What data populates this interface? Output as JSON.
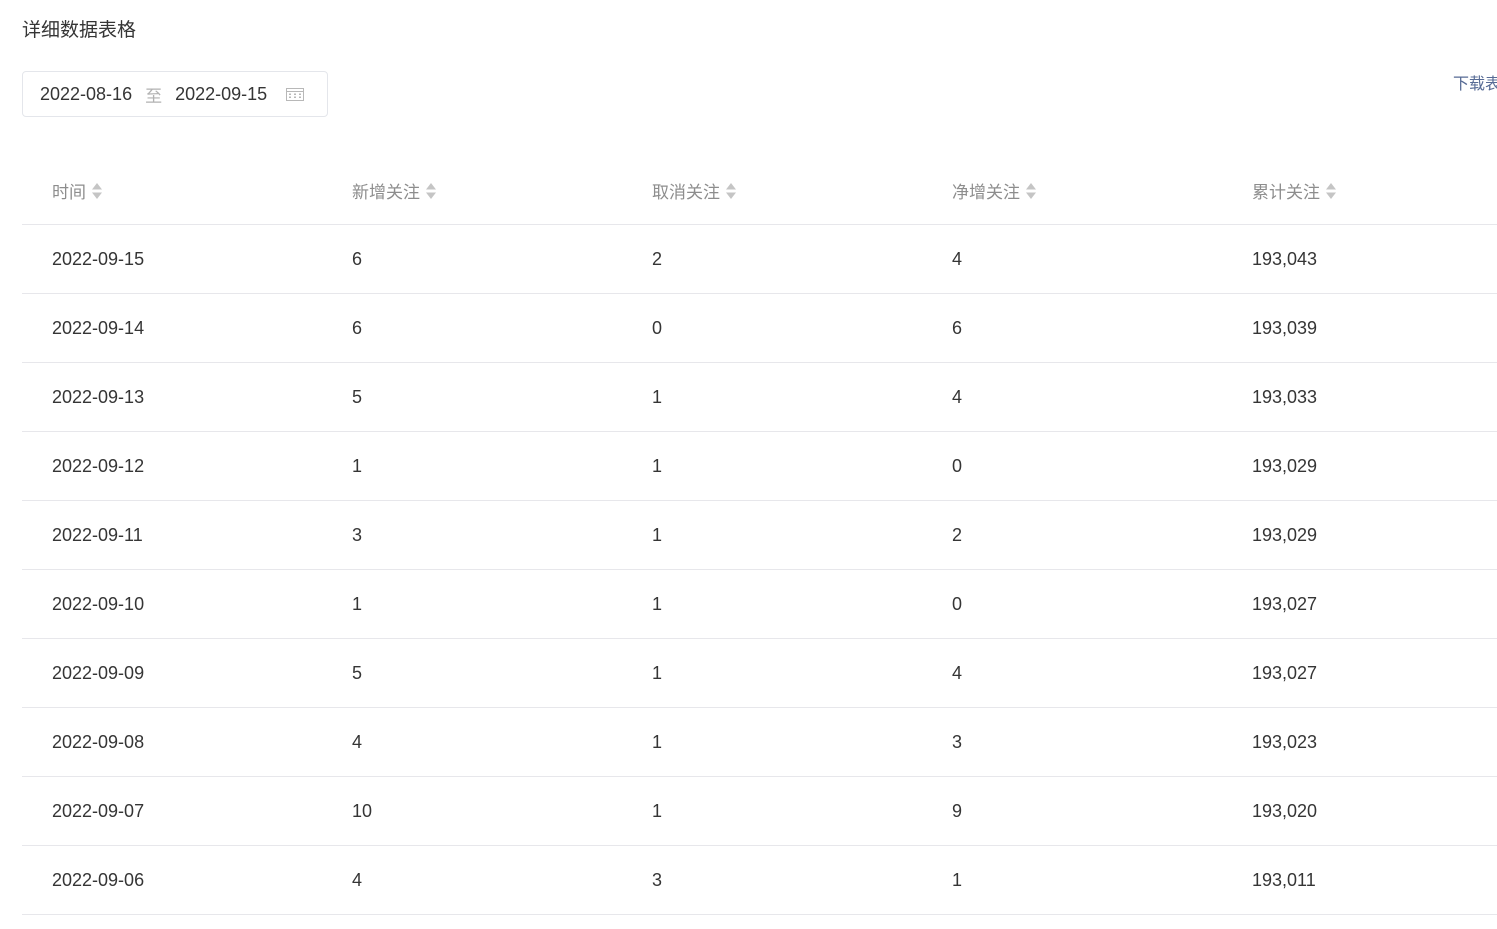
{
  "section": {
    "title": "详细数据表格"
  },
  "date_range": {
    "start": "2022-08-16",
    "separator": "至",
    "end": "2022-09-15",
    "icon": "calendar-icon"
  },
  "download": {
    "label": "下载表"
  },
  "table": {
    "columns": [
      "时间",
      "新增关注",
      "取消关注",
      "净增关注",
      "累计关注"
    ],
    "rows": [
      [
        "2022-09-15",
        "6",
        "2",
        "4",
        "193,043"
      ],
      [
        "2022-09-14",
        "6",
        "0",
        "6",
        "193,039"
      ],
      [
        "2022-09-13",
        "5",
        "1",
        "4",
        "193,033"
      ],
      [
        "2022-09-12",
        "1",
        "1",
        "0",
        "193,029"
      ],
      [
        "2022-09-11",
        "3",
        "1",
        "2",
        "193,029"
      ],
      [
        "2022-09-10",
        "1",
        "1",
        "0",
        "193,027"
      ],
      [
        "2022-09-09",
        "5",
        "1",
        "4",
        "193,027"
      ],
      [
        "2022-09-08",
        "4",
        "1",
        "3",
        "193,023"
      ],
      [
        "2022-09-07",
        "10",
        "1",
        "9",
        "193,020"
      ],
      [
        "2022-09-06",
        "4",
        "3",
        "1",
        "193,011"
      ]
    ]
  },
  "colors": {
    "text": "#353535",
    "header_text": "#8d8d8d",
    "link": "#576b95",
    "border": "#e7e7eb"
  }
}
